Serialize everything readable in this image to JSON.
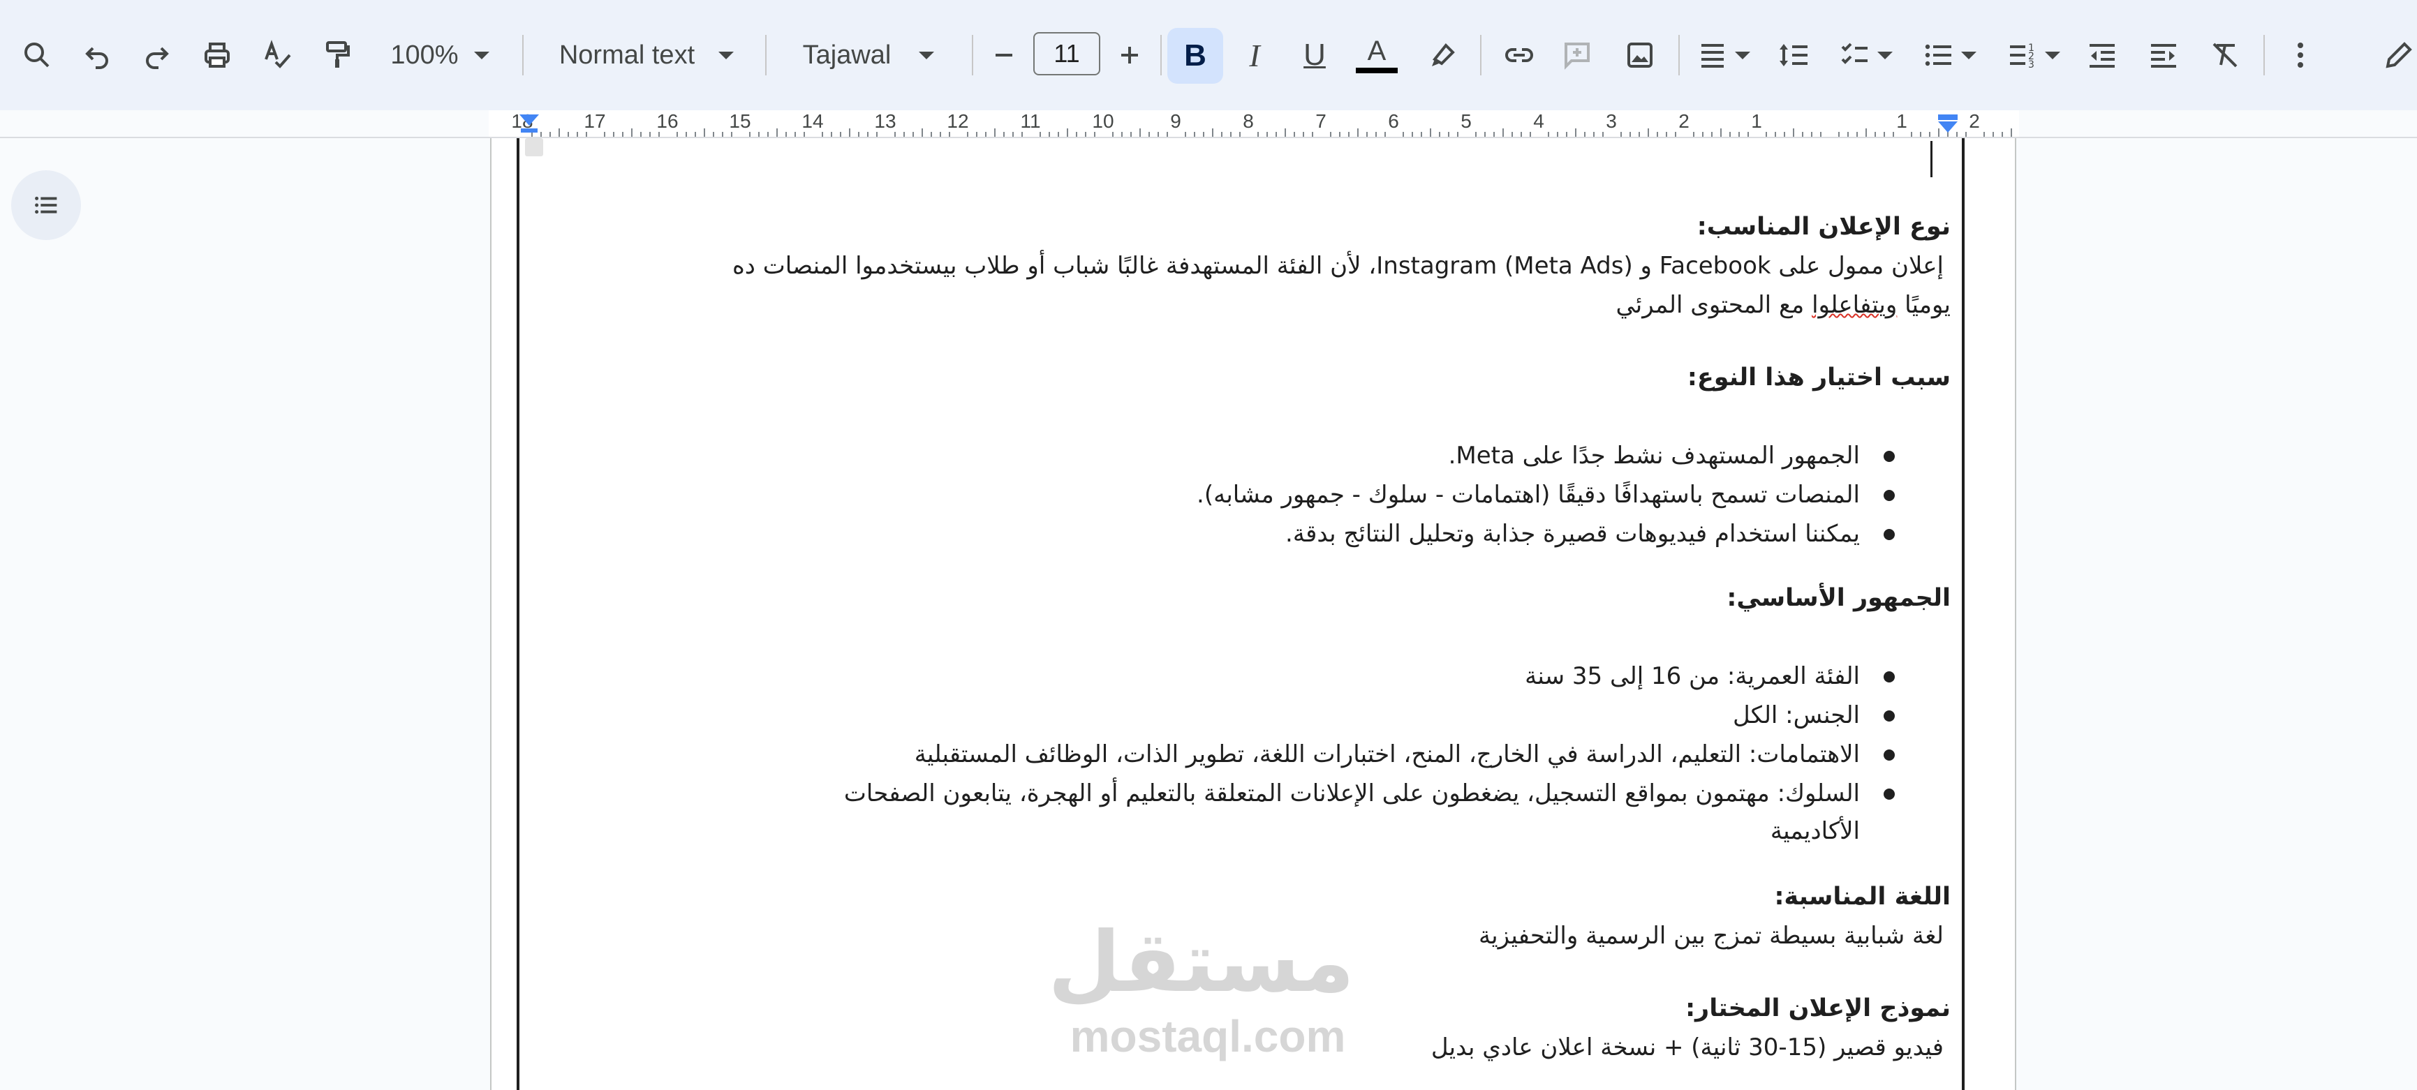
{
  "toolbar": {
    "zoom": "100%",
    "style": "Normal text",
    "font": "Tajawal",
    "font_size": "11",
    "icons": [
      "search-icon",
      "undo-icon",
      "redo-icon",
      "print-icon",
      "spellcheck-icon",
      "paint-format-icon",
      "decrease-size-icon",
      "increase-size-icon",
      "bold-icon",
      "italic-icon",
      "underline-icon",
      "text-color-icon",
      "highlight-icon",
      "link-icon",
      "comment-icon",
      "image-icon",
      "align-icon",
      "line-spacing-icon",
      "checklist-icon",
      "bullet-list-icon",
      "numbered-list-icon",
      "indent-decrease-icon",
      "indent-increase-icon",
      "clear-format-icon",
      "more-icon",
      "edit-mode-icon"
    ],
    "bold_label": "B",
    "italic_label": "I",
    "underline_label": "U",
    "text_color_label": "A",
    "text_color": "#000000",
    "accent": "#d3e3fd"
  },
  "ruler": {
    "numbers": [
      "18",
      "17",
      "16",
      "15",
      "14",
      "13",
      "12",
      "11",
      "10",
      "9",
      "8",
      "7",
      "6",
      "5",
      "4",
      "3",
      "2",
      "1",
      "",
      "1",
      "2"
    ]
  },
  "document": {
    "h1": "نوع الإعلان المناسب:",
    "p1_line1": "إعلان ممول على Facebook و Instagram (Meta Ads)، لأن الفئة المستهدفة غالبًا شباب أو طلاب بيستخدموا المنصات ده",
    "p1_line2_a": "يوميًا ",
    "p1_line2_b": "ويتفاعلوا",
    "p1_line2_c": " مع المحتوى المرئي",
    "h2": "سبب اختيار هذا النوع:",
    "reasons": [
      "الجمهور المستهدف نشط جدًا على Meta.",
      "المنصات تسمح باستهدافًا دقيقًا (اهتمامات - سلوك - جمهور مشابه).",
      "يمكننا استخدام فيديوهات قصيرة جذابة وتحليل النتائج بدقة."
    ],
    "h3": "الجمهور الأساسي:",
    "audience": [
      "الفئة العمرية: من 16 إلى 35 سنة",
      "الجنس: الكل",
      "الاهتمامات: التعليم، الدراسة في الخارج، المنح، اختبارات اللغة، تطوير الذات، الوظائف المستقبلية",
      "السلوك: مهتمون بمواقع التسجيل، يضغطون على الإعلانات المتعلقة بالتعليم أو الهجرة، يتابعون الصفحات",
      "الأكاديمية"
    ],
    "h4": "اللغة المناسبة:",
    "p4": "لغة شبابية بسيطة تمزج بين الرسمية والتحفيزية",
    "h5": "نموذج الإعلان المختار:",
    "p5": "فيديو قصير (15-30 ثانية) + نسخة اعلان عادي بديل"
  },
  "watermark": {
    "arabic": "مستقل",
    "latin": "mostaql.com"
  }
}
